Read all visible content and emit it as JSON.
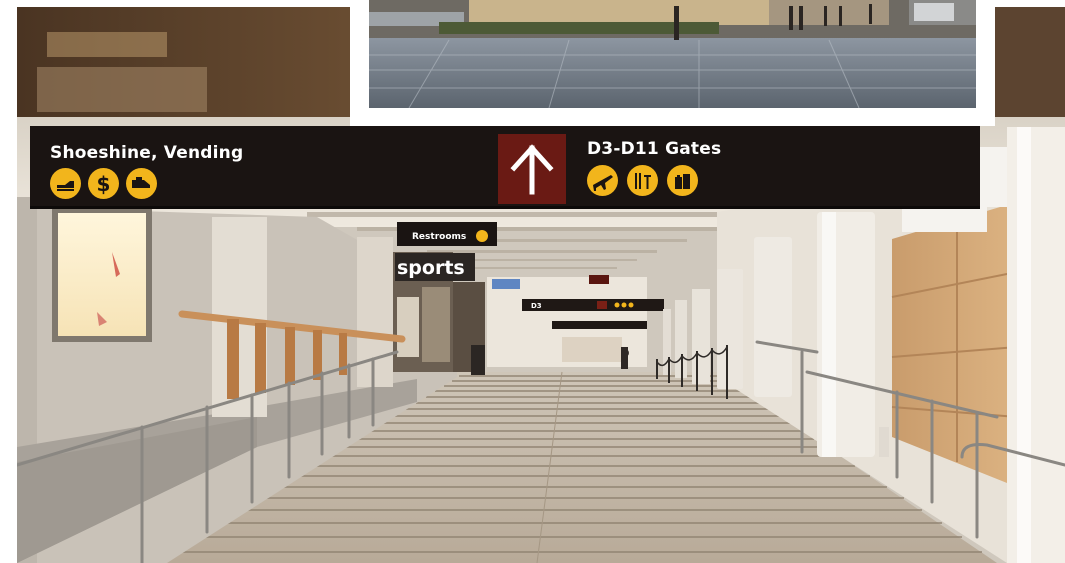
{
  "scene": {
    "description_kind": "airport-concourse-photo"
  },
  "overhead_sign": {
    "left_text": "Shoeshine, Vending",
    "right_text": "D3-D11 Gates",
    "left_icons": [
      "shoeshine-icon",
      "dollar-icon",
      "vending-icon"
    ],
    "right_icons": [
      "airplane-icon",
      "restaurant-icon",
      "shopping-icon"
    ],
    "arrow": "up-arrow-icon",
    "colors": {
      "sign_bg": "#1a1412",
      "arrow_box": "#6a1a14",
      "icon_yellow": "#f2b51c"
    }
  },
  "small_signs": {
    "restrooms": "Restrooms",
    "store": "sports",
    "gate": "D3"
  }
}
